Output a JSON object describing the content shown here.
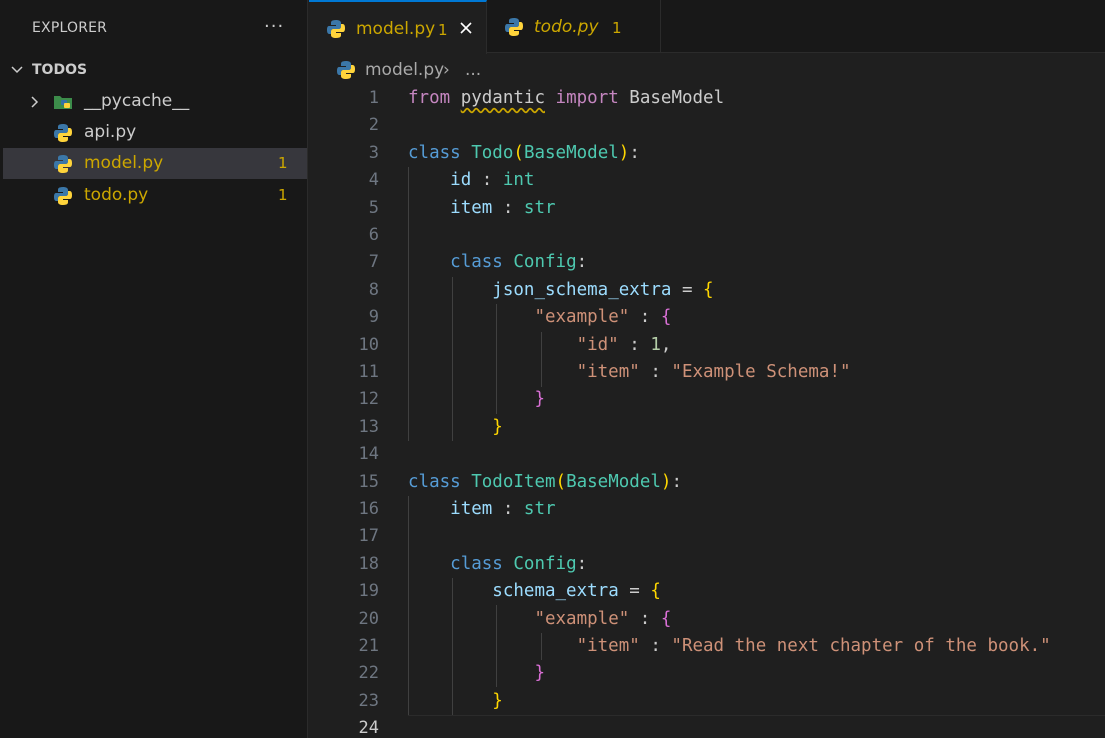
{
  "sidebar": {
    "title": "EXPLORER",
    "more_actions": "···",
    "folder": "TODOS",
    "items": [
      {
        "name": "__pycache__",
        "type": "folder",
        "badge": ""
      },
      {
        "name": "api.py",
        "type": "python",
        "badge": ""
      },
      {
        "name": "model.py",
        "type": "python",
        "badge": "1",
        "selected": true
      },
      {
        "name": "todo.py",
        "type": "python",
        "badge": "1"
      }
    ]
  },
  "tabs": [
    {
      "label": "model.py",
      "badge": "1",
      "active": true,
      "italic": false
    },
    {
      "label": "todo.py",
      "badge": "1",
      "active": false,
      "italic": true
    }
  ],
  "breadcrumb": {
    "file": "model.py",
    "separator": "›",
    "more": "..."
  },
  "editor": {
    "current_line": "24",
    "line_numbers": [
      "1",
      "2",
      "3",
      "4",
      "5",
      "6",
      "7",
      "8",
      "9",
      "10",
      "11",
      "12",
      "13",
      "14",
      "15",
      "16",
      "17",
      "18",
      "19",
      "20",
      "21",
      "22",
      "23",
      "24"
    ],
    "lines": [
      [
        {
          "t": "from",
          "c": "kw2"
        },
        {
          "t": " "
        },
        {
          "t": "pydantic",
          "c": "squiggle"
        },
        {
          "t": " "
        },
        {
          "t": "import",
          "c": "kw2"
        },
        {
          "t": " BaseModel"
        }
      ],
      [],
      [
        {
          "t": "class",
          "c": "kw"
        },
        {
          "t": " "
        },
        {
          "t": "Todo",
          "c": "cls"
        },
        {
          "t": "(",
          "c": "p1"
        },
        {
          "t": "BaseModel",
          "c": "cls"
        },
        {
          "t": ")",
          "c": "p1"
        },
        {
          "t": ":"
        }
      ],
      [
        {
          "t": "    "
        },
        {
          "t": "id",
          "c": "var"
        },
        {
          "t": " : "
        },
        {
          "t": "int",
          "c": "cls"
        }
      ],
      [
        {
          "t": "    "
        },
        {
          "t": "item",
          "c": "var"
        },
        {
          "t": " : "
        },
        {
          "t": "str",
          "c": "cls"
        }
      ],
      [],
      [
        {
          "t": "    "
        },
        {
          "t": "class",
          "c": "kw"
        },
        {
          "t": " "
        },
        {
          "t": "Config",
          "c": "cls"
        },
        {
          "t": ":"
        }
      ],
      [
        {
          "t": "        "
        },
        {
          "t": "json_schema_extra",
          "c": "var"
        },
        {
          "t": " = "
        },
        {
          "t": "{",
          "c": "p1"
        }
      ],
      [
        {
          "t": "            "
        },
        {
          "t": "\"example\"",
          "c": "str"
        },
        {
          "t": " : "
        },
        {
          "t": "{",
          "c": "p2"
        }
      ],
      [
        {
          "t": "                "
        },
        {
          "t": "\"id\"",
          "c": "str"
        },
        {
          "t": " : "
        },
        {
          "t": "1",
          "c": "num"
        },
        {
          "t": ","
        }
      ],
      [
        {
          "t": "                "
        },
        {
          "t": "\"item\"",
          "c": "str"
        },
        {
          "t": " : "
        },
        {
          "t": "\"Example Schema!\"",
          "c": "str"
        }
      ],
      [
        {
          "t": "            "
        },
        {
          "t": "}",
          "c": "p2"
        }
      ],
      [
        {
          "t": "        "
        },
        {
          "t": "}",
          "c": "p1"
        }
      ],
      [],
      [
        {
          "t": "class",
          "c": "kw"
        },
        {
          "t": " "
        },
        {
          "t": "TodoItem",
          "c": "cls"
        },
        {
          "t": "(",
          "c": "p1"
        },
        {
          "t": "BaseModel",
          "c": "cls"
        },
        {
          "t": ")",
          "c": "p1"
        },
        {
          "t": ":"
        }
      ],
      [
        {
          "t": "    "
        },
        {
          "t": "item",
          "c": "var"
        },
        {
          "t": " : "
        },
        {
          "t": "str",
          "c": "cls"
        }
      ],
      [],
      [
        {
          "t": "    "
        },
        {
          "t": "class",
          "c": "kw"
        },
        {
          "t": " "
        },
        {
          "t": "Config",
          "c": "cls"
        },
        {
          "t": ":"
        }
      ],
      [
        {
          "t": "        "
        },
        {
          "t": "schema_extra",
          "c": "var"
        },
        {
          "t": " = "
        },
        {
          "t": "{",
          "c": "p1"
        }
      ],
      [
        {
          "t": "            "
        },
        {
          "t": "\"example\"",
          "c": "str"
        },
        {
          "t": " : "
        },
        {
          "t": "{",
          "c": "p2"
        }
      ],
      [
        {
          "t": "                "
        },
        {
          "t": "\"item\"",
          "c": "str"
        },
        {
          "t": " : "
        },
        {
          "t": "\"Read the next chapter of the book.\"",
          "c": "str"
        }
      ],
      [
        {
          "t": "            "
        },
        {
          "t": "}",
          "c": "p2"
        }
      ],
      [
        {
          "t": "        "
        },
        {
          "t": "}",
          "c": "p1"
        }
      ],
      []
    ]
  },
  "colors": {
    "accent": "#0078d4",
    "warning": "#cca700",
    "editor_bg": "#1f1f1f",
    "sidebar_bg": "#181818"
  }
}
